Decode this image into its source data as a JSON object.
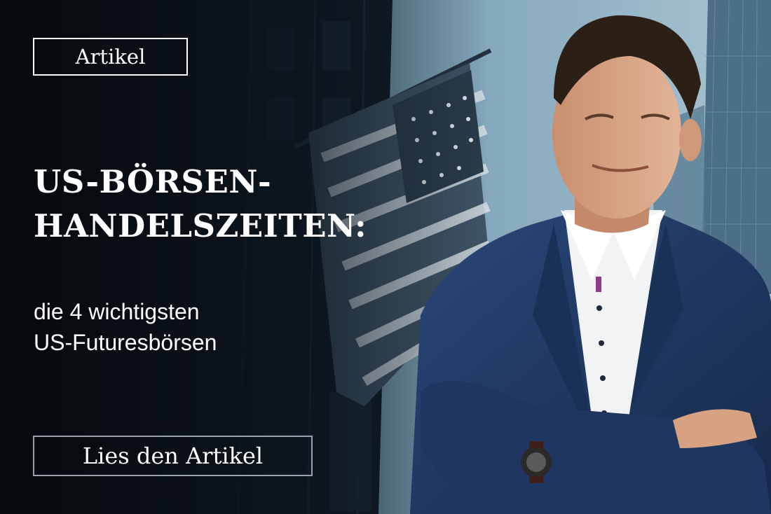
{
  "badge": {
    "label": "Artikel"
  },
  "headline": {
    "line1": "US-BÖRSEN-",
    "line2": "HANDELSZEITEN:"
  },
  "subheadline": {
    "line1": "die 4 wichtigsten",
    "line2": "US-Futuresbörsen"
  },
  "cta": {
    "label": "Lies den Artikel"
  },
  "colors": {
    "text": "#ffffff",
    "background_dark": "#0a0f16",
    "sky": "#8fb2c6",
    "suit": "#1f3b63",
    "cta_border": "#9aa3ad"
  }
}
